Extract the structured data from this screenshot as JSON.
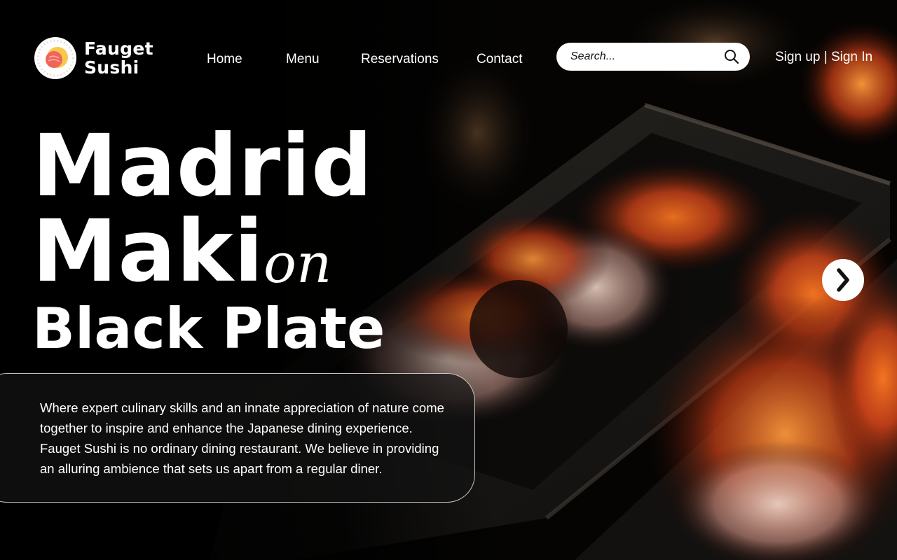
{
  "brand": {
    "name_line1": "Fauget",
    "name_line2": "Sushi",
    "logo_icon": "sushi-roll-icon"
  },
  "nav": {
    "items": [
      {
        "label": "Home"
      },
      {
        "label": "Menu"
      },
      {
        "label": "Reservations"
      },
      {
        "label": "Contact"
      }
    ]
  },
  "search": {
    "placeholder": "Search...",
    "icon": "search-icon"
  },
  "auth": {
    "signup": "Sign up",
    "separator": "|",
    "signin": "Sign In"
  },
  "hero": {
    "title_line1": "Madrid",
    "title_line2": "Maki",
    "title_script": "on",
    "title_line3": "Black Plate",
    "description": "Where expert culinary skills and an innate appreciation of nature come together to inspire and enhance the Japanese dining experience. Fauget Sushi is no ordinary dining restaurant. We believe in providing an alluring ambience that sets us apart from a regular diner.",
    "next_icon": "chevron-right-icon"
  },
  "colors": {
    "background": "#000000",
    "text": "#ffffff",
    "accent_orange": "#e0561c",
    "logo_red": "#f0655a",
    "logo_yellow": "#f7c84a"
  }
}
